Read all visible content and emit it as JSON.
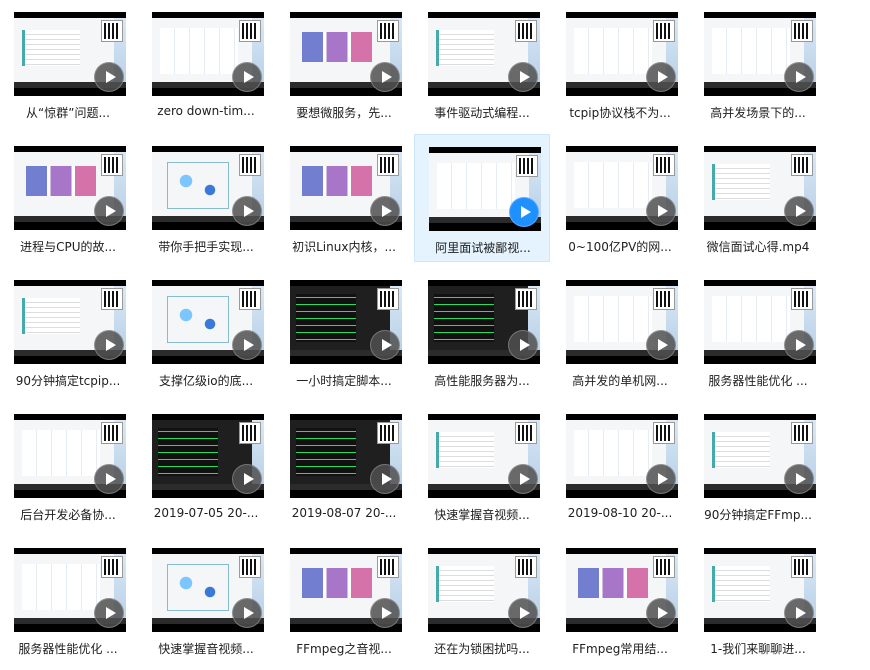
{
  "videos": [
    {
      "label": "从“惊群”问题...",
      "style": "a"
    },
    {
      "label": "zero down-tim...",
      "style": "e"
    },
    {
      "label": "要想微服务，先...",
      "style": "b"
    },
    {
      "label": "事件驱动式编程...",
      "style": "a"
    },
    {
      "label": "tcpip协议栈不为...",
      "style": "e"
    },
    {
      "label": "高并发场景下的...",
      "style": "e"
    },
    {
      "label": "进程与CPU的故...",
      "style": "b"
    },
    {
      "label": "带你手把手实现...",
      "style": "d"
    },
    {
      "label": "初识Linux内核，...",
      "style": "b"
    },
    {
      "label": "阿里面试被鄙视...",
      "style": "e",
      "selected": true
    },
    {
      "label": "0~100亿PV的网...",
      "style": "e"
    },
    {
      "label": "微信面试心得.mp4",
      "style": "a"
    },
    {
      "label": "90分钟搞定tcpip...",
      "style": "a"
    },
    {
      "label": "支撑亿级io的底...",
      "style": "d"
    },
    {
      "label": "一小时搞定脚本...",
      "style": "c"
    },
    {
      "label": "高性能服务器为...",
      "style": "c"
    },
    {
      "label": "高并发的单机网...",
      "style": "e"
    },
    {
      "label": "服务器性能优化 ...",
      "style": "e"
    },
    {
      "label": "后台开发必备协...",
      "style": "e"
    },
    {
      "label": "2019-07-05 20-...",
      "style": "c"
    },
    {
      "label": "2019-08-07 20-...",
      "style": "c"
    },
    {
      "label": "快速掌握音视频...",
      "style": "a"
    },
    {
      "label": "2019-08-10 20-...",
      "style": "e"
    },
    {
      "label": "90分钟搞定FFmp...",
      "style": "a"
    },
    {
      "label": "服务器性能优化 ...",
      "style": "e"
    },
    {
      "label": "快速掌握音视频...",
      "style": "d"
    },
    {
      "label": "FFmpeg之音视...",
      "style": "b"
    },
    {
      "label": "还在为锁困扰吗...",
      "style": "a"
    },
    {
      "label": "FFmpeg常用结...",
      "style": "b"
    },
    {
      "label": "1-我们来聊聊进...",
      "style": "a"
    }
  ]
}
